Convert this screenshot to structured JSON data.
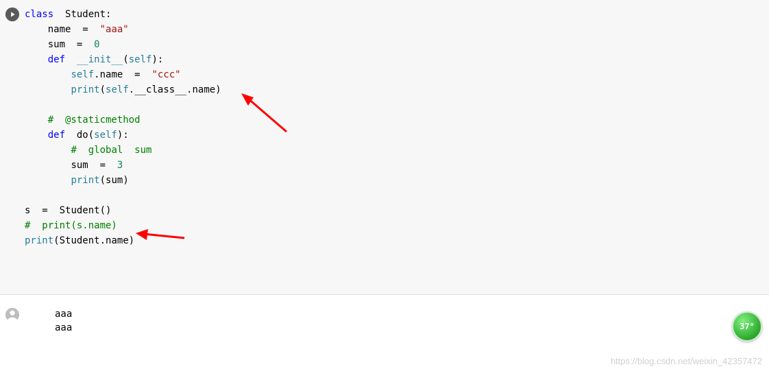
{
  "code": {
    "l1": {
      "kw": "class",
      "sp": "  ",
      "cls": "Student",
      "p": ":"
    },
    "l2": {
      "indent": "    ",
      "id": "name",
      "sp1": "  ",
      "eq": "=",
      "sp2": "  ",
      "str": "\"aaa\""
    },
    "l3": {
      "indent": "    ",
      "id": "sum",
      "sp1": "  ",
      "eq": "=",
      "sp2": "  ",
      "num": "0"
    },
    "l4": {
      "indent": "    ",
      "kw": "def",
      "sp": "  ",
      "fn": "__init__",
      "p1": "(",
      "self": "self",
      "p2": "):"
    },
    "l5": {
      "indent": "        ",
      "self": "self",
      "dot": ".",
      "attr": "name",
      "sp1": "  ",
      "eq": "=",
      "sp2": "  ",
      "str": "\"ccc\""
    },
    "l6": {
      "indent": "        ",
      "bi": "print",
      "p1": "(",
      "self": "self",
      "dot1": ".",
      "cls": "__class__",
      "dot2": ".",
      "attr": "name",
      "p2": ")"
    },
    "l7": {
      "indent": "    ",
      "cmt": "#  @staticmethod"
    },
    "l8": {
      "indent": "    ",
      "kw": "def",
      "sp": "  ",
      "fn": "do",
      "p1": "(",
      "self": "self",
      "p2": "):"
    },
    "l9": {
      "indent": "        ",
      "cmt": "#  global  sum"
    },
    "l10": {
      "indent": "        ",
      "id": "sum",
      "sp1": "  ",
      "eq": "=",
      "sp2": "  ",
      "num": "3"
    },
    "l11": {
      "indent": "        ",
      "bi": "print",
      "p1": "(",
      "id": "sum",
      "p2": ")"
    },
    "l12": {
      "id": "s",
      "sp1": "  ",
      "eq": "=",
      "sp2": "  ",
      "cls": "Student",
      "p": "()"
    },
    "l13": {
      "cmt": "#  print(s.name)"
    },
    "l14": {
      "bi": "print",
      "p1": "(",
      "cls": "Student",
      "dot": ".",
      "attr": "name",
      "p2": ")"
    }
  },
  "output": {
    "line1": "aaa",
    "line2": "aaa"
  },
  "badge_text": "37°",
  "watermark": "https://blog.csdn.net/weixin_42357472"
}
